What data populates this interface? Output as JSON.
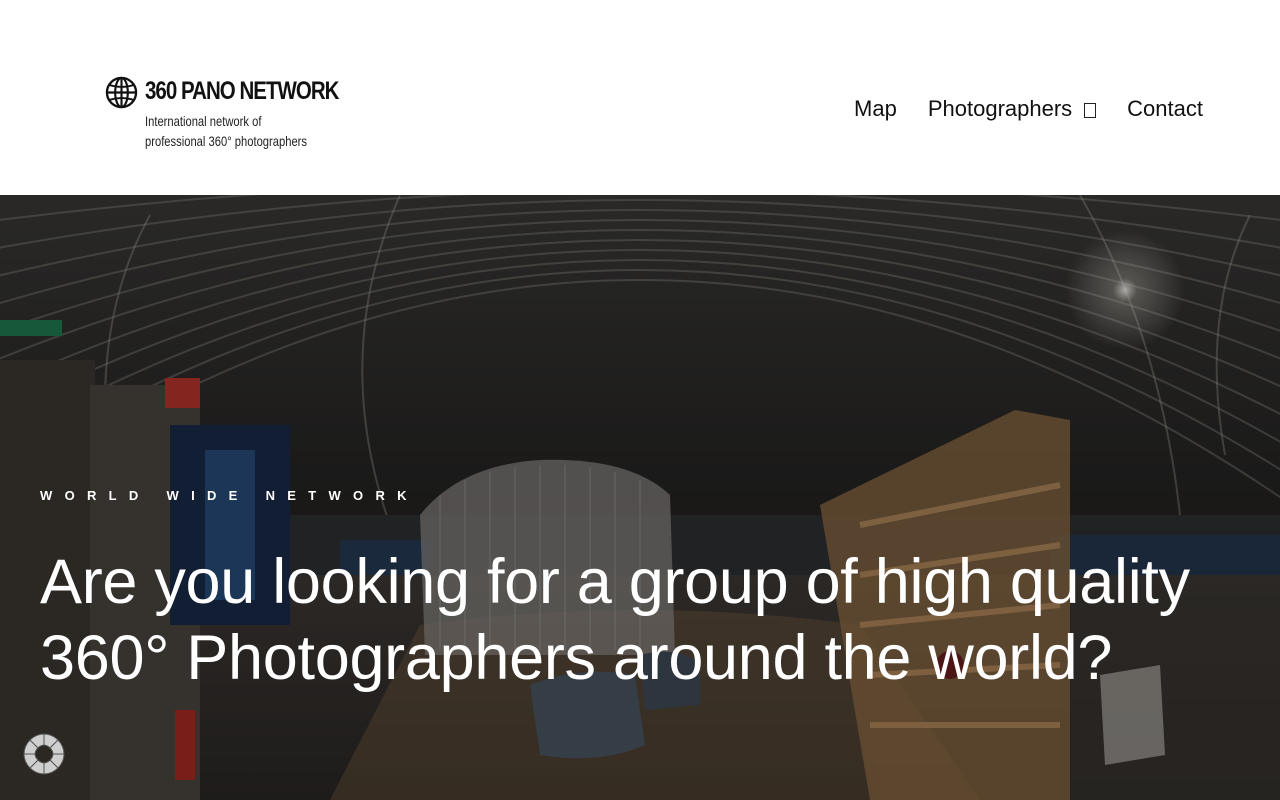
{
  "brand": {
    "name": "360 PANO NETWORK",
    "tagline_line1": "International network of",
    "tagline_line2": "professional 360° photographers",
    "icon": "globe-icon"
  },
  "nav": {
    "items": [
      {
        "label": "Map"
      },
      {
        "label": "Photographers",
        "icon": "chevron-down-icon"
      },
      {
        "label": "Contact"
      }
    ]
  },
  "hero": {
    "eyebrow": "WORLD WIDE NETWORK",
    "headline": "Are you looking for a group of high quality 360° Photographers around the world?",
    "background": "panorama-image",
    "loader_icon": "spinner-icon"
  },
  "colors": {
    "header_bg": "#ffffff",
    "text_dark": "#111111",
    "hero_text": "#ffffff"
  }
}
